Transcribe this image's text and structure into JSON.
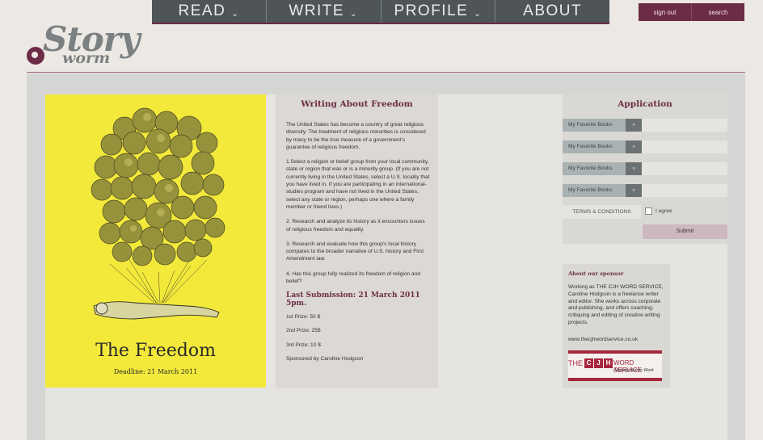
{
  "nav": {
    "items": [
      {
        "label": "READ",
        "has_caret": true
      },
      {
        "label": "WRITE",
        "has_caret": true
      },
      {
        "label": "PROFILE",
        "has_caret": true
      },
      {
        "label": "ABOUT",
        "has_caret": false
      }
    ],
    "caret": "⌄",
    "sign_out": "sign out",
    "search": "search"
  },
  "logo": {
    "story": "Story",
    "worm": "worm"
  },
  "colors": {
    "brand": "#6d2c46",
    "nav": "#4f5556",
    "poster": "#f3e93b"
  },
  "poster": {
    "title": "The Freedom",
    "deadline": "Deadline: 21 March 2011"
  },
  "article": {
    "title": "Writing About Freedom",
    "paragraphs": [
      "The United States has become a country of great religious diversity. The treatment of religious minorities is considered by many to be the true measure of a government's guarantee of religious freedom.",
      "1.Select a religion or belief group from your local community, state or region that was or is a minority group. (If you are not currently living in the United States, select a U.S. locality that you have lived in. If you are participating in an international-studies program and have not lived in the United States, select any state or region, perhaps one where a family member or friend lives.)",
      "2. Research and analyze its history as it encounters issues of religious freedom and equality.",
      "3. Research and evaluate how this group's local history compares to the broader narrative of U.S. history and First Amendment law.",
      "4. Has this group fully realized its freedom of religion and belief?"
    ],
    "last_submission": "Last Submission: 21 March 2011 5pm.",
    "prizes": [
      "1st Prize: 50 $",
      "2nd Prize: 25$",
      "3rd Prize: 10 $"
    ],
    "sponsored_by": "Sponsored by Caroline Hodgson"
  },
  "application": {
    "title": "Application",
    "selects": [
      "My Favorite Books",
      "My Favorite Books",
      "My Favorite Books",
      "My Favorite Books"
    ],
    "arrow": "»",
    "terms": "TERMS & CONDITIONS",
    "agree": "I agree",
    "submit": "Submit"
  },
  "sponsor": {
    "heading": "About our sponsor",
    "text": "Working as THE CJH WORD SERVICE, Caroline Hodgson is a freelance writer and editor. She works across corporate and publishing, and offers coaching, critiquing and editing of creative writing projects.",
    "url": "www.thecjhwordservice.co.uk",
    "logo": {
      "the": "THE",
      "c": "C",
      "j": "J",
      "h": "H",
      "word_service": "WORD SERVICE",
      "tagline": "- Making Words Work"
    }
  }
}
